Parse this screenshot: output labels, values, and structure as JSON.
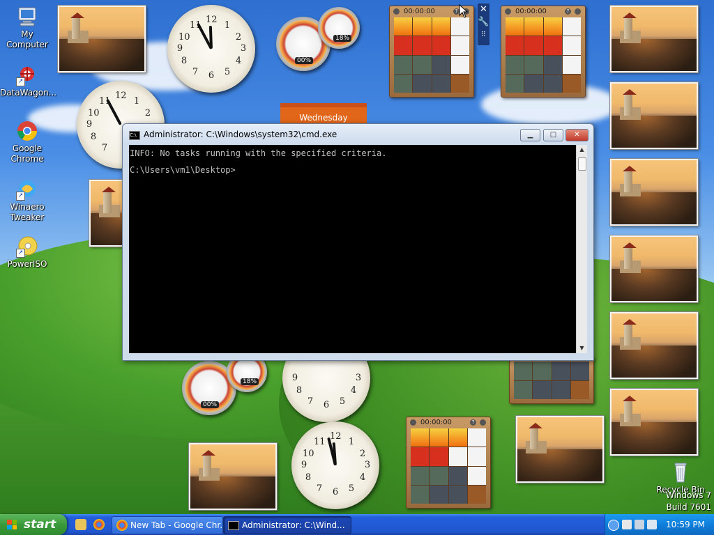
{
  "desktop_icons": [
    {
      "label": "My Computer"
    },
    {
      "label": "DataWagon..."
    },
    {
      "label": "Google Chrome"
    },
    {
      "label": "Winaero Tweaker"
    },
    {
      "label": "PowerISO"
    },
    {
      "label": "Recycle Bin"
    }
  ],
  "gadgets": {
    "meter_cpu": "00%",
    "meter_mem": "18%",
    "calendar_day": "Wednesday",
    "puzzle_timers": [
      "00:00:00",
      "00:00:00",
      "00:00:00"
    ],
    "puzzle_help": "?",
    "clock_numbers": [
      "12",
      "1",
      "2",
      "3",
      "4",
      "5",
      "6",
      "7",
      "8",
      "9",
      "10",
      "11"
    ]
  },
  "cmd_window": {
    "title": "Administrator: C:\\Windows\\system32\\cmd.exe",
    "icon_text": "C:\\",
    "lines": [
      "INFO: No tasks running with the specified criteria.",
      "C:\\Users\\vm1\\Desktop>"
    ],
    "minimize": "▁",
    "maximize": "□",
    "close": "✕"
  },
  "os_watermark": {
    "line1": "Windows 7",
    "line2": "Build 7601"
  },
  "taskbar": {
    "start_label": "start",
    "tasks": [
      {
        "label": "New Tab - Google Chr..."
      },
      {
        "label": "Administrator: C:\\Wind..."
      }
    ],
    "clock": "10:59 PM"
  },
  "colors": {
    "taskbar": "#245edb",
    "start": "#3a9a3a",
    "console_bg": "#000000",
    "console_fg": "#c0c0c0"
  }
}
